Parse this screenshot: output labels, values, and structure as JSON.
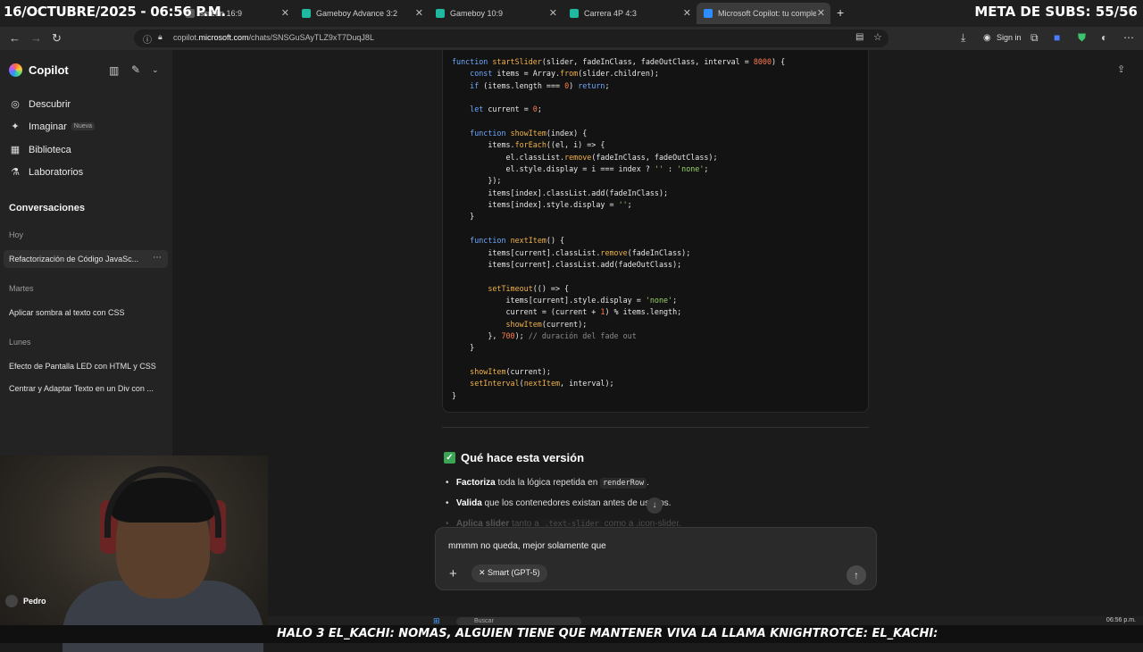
{
  "overlay": {
    "date": "16/OCTUBRE/2025 - 06:56 P.M.",
    "subs": "META DE SUBS: 55/56"
  },
  "tabs": [
    {
      "label": "screen 16:9",
      "color": "#5a5a5a",
      "active": false
    },
    {
      "label": "Gameboy Advance 3:2",
      "color": "#1fb8a0",
      "active": false
    },
    {
      "label": "Gameboy 10:9",
      "color": "#1fb8a0",
      "active": false
    },
    {
      "label": "Carrera 4P 4:3",
      "color": "#1fb8a0",
      "active": false
    },
    {
      "label": "Microsoft Copilot: tu compleme",
      "color": "#2f8cff",
      "active": true
    }
  ],
  "address": {
    "url_pre": "copilot.",
    "url_host": "microsoft.com",
    "url_path": "/chats/SNSGuSAyTLZ9xT7DuqJ8L",
    "signin": "Sign in"
  },
  "sidebar": {
    "brand": "Copilot",
    "nav": [
      {
        "label": "Descubrir",
        "icon": "compass-icon"
      },
      {
        "label": "Imaginar",
        "icon": "sparkle-icon",
        "badge": "Nueva"
      },
      {
        "label": "Biblioteca",
        "icon": "library-icon"
      },
      {
        "label": "Laboratorios",
        "icon": "flask-icon"
      }
    ],
    "conversations_title": "Conversaciones",
    "groups": [
      {
        "day": "Hoy",
        "items": [
          "Refactorización de Código JavaSc..."
        ]
      },
      {
        "day": "Martes",
        "items": [
          "Aplicar sombra al texto con CSS"
        ]
      },
      {
        "day": "Lunes",
        "items": [
          "Efecto de Pantalla LED con HTML y CSS",
          "Centrar y Adaptar Texto en un Div con ..."
        ]
      }
    ]
  },
  "code": {
    "lines": [
      "function startSlider(slider, fadeInClass, fadeOutClass, interval = 8000) {",
      "    const items = Array.from(slider.children);",
      "    if (items.length === 0) return;",
      "",
      "    let current = 0;",
      "",
      "    function showItem(index) {",
      "        items.forEach((el, i) => {",
      "            el.classList.remove(fadeInClass, fadeOutClass);",
      "            el.style.display = i === index ? '' : 'none';",
      "        });",
      "        items[index].classList.add(fadeInClass);",
      "        items[index].style.display = '';",
      "    }",
      "",
      "    function nextItem() {",
      "        items[current].classList.remove(fadeInClass);",
      "        items[current].classList.add(fadeOutClass);",
      "",
      "        setTimeout(() => {",
      "            items[current].style.display = 'none';",
      "            current = (current + 1) % items.length;",
      "            showItem(current);",
      "        }, 700); // duración del fade out",
      "    }",
      "",
      "    showItem(current);",
      "    setInterval(nextItem, interval);",
      "}"
    ]
  },
  "response": {
    "heading": "Qué hace esta versión",
    "bullets": [
      {
        "bold": "Factoriza",
        "text": " toda la lógica repetida en ",
        "code": "renderRow",
        "tail": "."
      },
      {
        "bold": "Valida",
        "text": " que los contenedores existan antes de usarlos.",
        "code": "",
        "tail": ""
      },
      {
        "bold": "Aplica slider",
        "text": " tanto a ",
        "code": ".text-slider",
        "tail": " como a .icon-slider."
      }
    ]
  },
  "composer": {
    "text": "mmmm no queda, mejor solamente que",
    "model_chip": "Smart (GPT-5)"
  },
  "stream": {
    "streamer_name": "Pedro",
    "ticker": "HALO 3  EL_KACHI: NOMAS, ALGUIEN TIENE QUE MANTENER VIVA LA LLAMA  KNIGHTROTCE:  EL_KACHI:",
    "taskbar_search": "Buscar",
    "clock": "06:56 p.m."
  }
}
